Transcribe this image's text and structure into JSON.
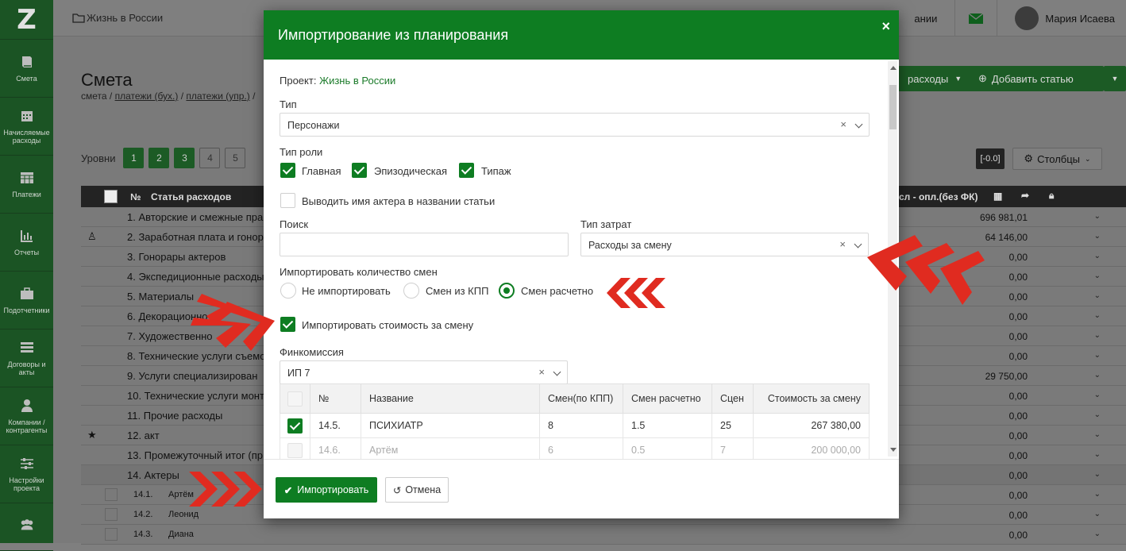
{
  "sidebar": {
    "logo": "Z",
    "items": [
      {
        "label": "Смета",
        "icon": "book-icon"
      },
      {
        "label": "Начисляемые расходы",
        "icon": "calendar-icon"
      },
      {
        "label": "Платежи",
        "icon": "table-icon"
      },
      {
        "label": "Отчеты",
        "icon": "bar-chart-icon"
      },
      {
        "label": "Подотчетники",
        "icon": "briefcase-icon"
      },
      {
        "label": "Договоры и акты",
        "icon": "list-icon"
      },
      {
        "label": "Компании / контрагенты",
        "icon": "user-icon"
      },
      {
        "label": "Настройки проекта",
        "icon": "sliders-icon"
      },
      {
        "label": "",
        "icon": "users-icon"
      }
    ]
  },
  "topbar": {
    "project": "Жизнь в России",
    "truncated_text": "ании",
    "user_name": "Мария Исаева"
  },
  "page": {
    "title": "Смета",
    "crumbs": [
      "смета",
      "платежи (бух.)",
      "платежи (упр.)"
    ],
    "btn_expenses": "расходы",
    "btn_add": "Добавить статью",
    "levels_label": "Уровни",
    "levels": [
      "1",
      "2",
      "3",
      "4",
      "5"
    ],
    "zero_badge": "[-0.0]",
    "columns_btn": "Столбцы",
    "head_num": "№",
    "head_title": "Статья расходов",
    "head_right": "сл - опл.(без ФК)",
    "rows": [
      {
        "name": "1. Авторские и смежные пра",
        "value": "696 981,01"
      },
      {
        "name": "2. Заработная плата и гонор",
        "value": "64 146,00"
      },
      {
        "name": "3. Гонорары актеров",
        "value": "0,00"
      },
      {
        "name": "4. Экспедиционные расходы",
        "value": "0,00"
      },
      {
        "name": "5. Материалы",
        "value": "0,00"
      },
      {
        "name": "6. Декорационно",
        "value": "0,00"
      },
      {
        "name": "7. Художественно",
        "value": "0,00"
      },
      {
        "name": "8. Технические услуги съемо",
        "value": "0,00"
      },
      {
        "name": "9. Услуги специализирован",
        "value": "29 750,00"
      },
      {
        "name": "10. Технические услуги монт",
        "value": "0,00"
      },
      {
        "name": "11. Прочие расходы",
        "value": "0,00"
      },
      {
        "name": "12. акт",
        "value": "0,00"
      },
      {
        "name": "13. Промежуточный итог (пр",
        "value": "0,00"
      },
      {
        "name": "14. Актеры",
        "value": "0,00"
      }
    ],
    "sub_rows": [
      {
        "num": "14.1.",
        "name": "Артём",
        "value": "0,00"
      },
      {
        "num": "14.2.",
        "name": "Леонид",
        "value": "0,00"
      },
      {
        "num": "14.3.",
        "name": "Диана",
        "value": "0,00"
      }
    ]
  },
  "modal": {
    "title": "Импортирование из планирования",
    "close": "×",
    "project_label": "Проект:",
    "project_value": "Жизнь в России",
    "type_label": "Тип",
    "type_value": "Персонажи",
    "role_label": "Тип роли",
    "roles": [
      "Главная",
      "Эпизодическая",
      "Типаж"
    ],
    "actor_name_label": "Выводить имя актера в названии статьи",
    "search_label": "Поиск",
    "search_value": "",
    "cost_type_label": "Тип затрат",
    "cost_type_value": "Расходы за смену",
    "shifts_label": "Импортировать количество смен",
    "shift_options": [
      "Не импортировать",
      "Смен из КПП",
      "Смен расчетно"
    ],
    "shift_selected": "Смен расчетно",
    "import_cost_label": "Импортировать стоимость за смену",
    "fincom_label": "Финкомиссия",
    "fincom_value": "ИП 7",
    "table": {
      "headers": [
        "№",
        "Название",
        "Смен(по КПП)",
        "Смен расчетно",
        "Сцен",
        "Стоимость за смену"
      ],
      "rows": [
        {
          "checked": true,
          "num": "14.5.",
          "name": "ПСИХИАТР",
          "kpp": "8",
          "calc": "1.5",
          "scenes": "25",
          "cost": "267 380,00"
        },
        {
          "checked": false,
          "num": "14.6.",
          "name": "Артём",
          "kpp": "6",
          "calc": "0.5",
          "scenes": "7",
          "cost": "200 000,00"
        }
      ]
    },
    "import_btn": "Импортировать",
    "cancel_btn": "Отмена"
  },
  "colors": {
    "primary_green": "#0e7d22",
    "sidebar_green": "#1b5424",
    "arrow_red": "#e02b20"
  }
}
